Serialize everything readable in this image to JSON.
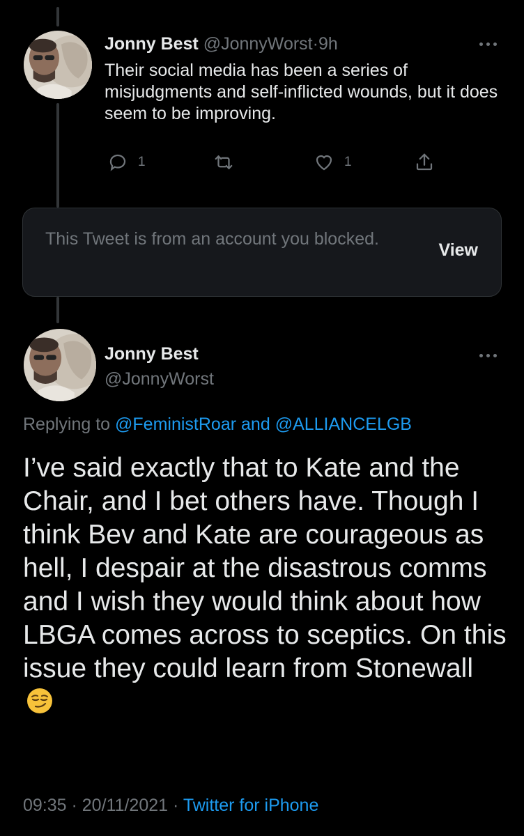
{
  "tweet1": {
    "display_name": "Jonny Best",
    "handle": "@JonnyWorst",
    "separator": "·",
    "time": "9h",
    "text": "Their social media has been a series of misjudgments and self-inflicted wounds, but it does seem to be improving.",
    "actions": {
      "reply_count": "1",
      "retweet_count": "",
      "like_count": "1"
    }
  },
  "blocked_notice": {
    "text": "This Tweet is from an account you blocked.",
    "view_label": "View"
  },
  "tweet2": {
    "display_name": "Jonny Best",
    "handle": "@JonnyWorst",
    "replying_prefix": "Replying to",
    "reply_to_1": "@FeministRoar",
    "reply_and": "and",
    "reply_to_2": "@ALLIANCELGB",
    "text": "I’ve said exactly that to Kate and the Chair, and I bet others have. Though I think Bev and Kate are courageous as hell, I despair at the disastrous comms and I wish they would think about how LBGA comes across to sceptics. On this issue they could learn from Stonewall",
    "emoji": "smirking-face",
    "timestamp": "09:35 · 20/11/2021",
    "separator": "·",
    "source": "Twitter for iPhone"
  },
  "colors": {
    "background": "#000000",
    "text": "#e7e9ea",
    "muted": "#71767b",
    "link": "#1d9bf0",
    "blocked_bg": "#16181c"
  }
}
